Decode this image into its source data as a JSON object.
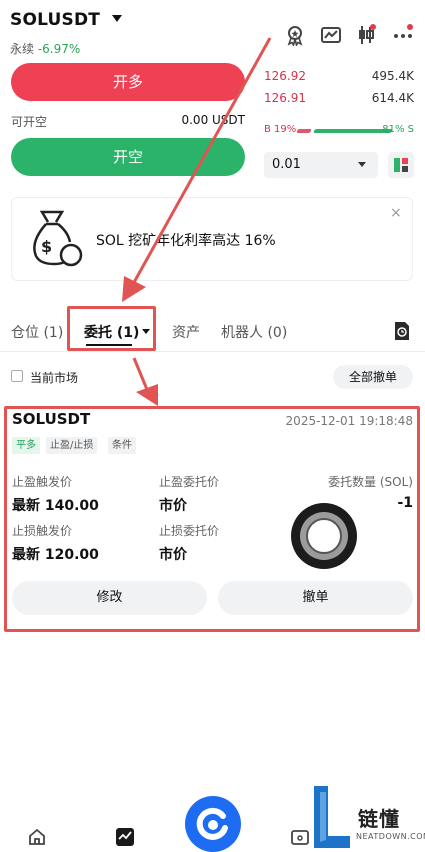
{
  "header": {
    "symbol": "SOLUSDT",
    "contract_type": "永续",
    "change_pct": "-6.97%"
  },
  "orderbook": {
    "rows": [
      {
        "price": "126.92",
        "qty": "495.4K"
      },
      {
        "price": "126.91",
        "qty": "614.4K"
      }
    ],
    "buy_pct": "B 19%",
    "sell_pct": "81% S"
  },
  "trade": {
    "long_label": "开多",
    "short_label": "开空",
    "avail_label": "可开空",
    "avail_value": "0.00 USDT",
    "precision_value": "0.01"
  },
  "banner": {
    "text": "SOL 挖矿年化利率高达 16%",
    "close": "×"
  },
  "tabs": [
    {
      "label": "仓位 (1)"
    },
    {
      "label": "委托 (1)"
    },
    {
      "label": "资产"
    },
    {
      "label": "机器人 (0)"
    }
  ],
  "filter": {
    "current_market": "当前市场",
    "cancel_all": "全部撤单"
  },
  "order": {
    "symbol": "SOLUSDT",
    "time": "2025-12-01 19:18:48",
    "tags": [
      "平多",
      "止盈/止损",
      "条件"
    ],
    "fields": [
      {
        "label": "止盈触发价",
        "value": "最新 140.00"
      },
      {
        "label": "止盈委托价",
        "value": "市价"
      },
      {
        "label": "委托数量 (SOL)",
        "value": "-1"
      },
      {
        "label": "止损触发价",
        "value": "最新 120.00"
      },
      {
        "label": "止损委托价",
        "value": "市价"
      }
    ],
    "modify_label": "修改",
    "cancel_label": "撤单"
  },
  "watermark": {
    "name": "链懂",
    "site": "NEATDOWN.COM"
  },
  "colors": {
    "long": "#ef4154",
    "short": "#2bb36a",
    "annotation": "#e05454",
    "brand": "#1e6cf2"
  }
}
